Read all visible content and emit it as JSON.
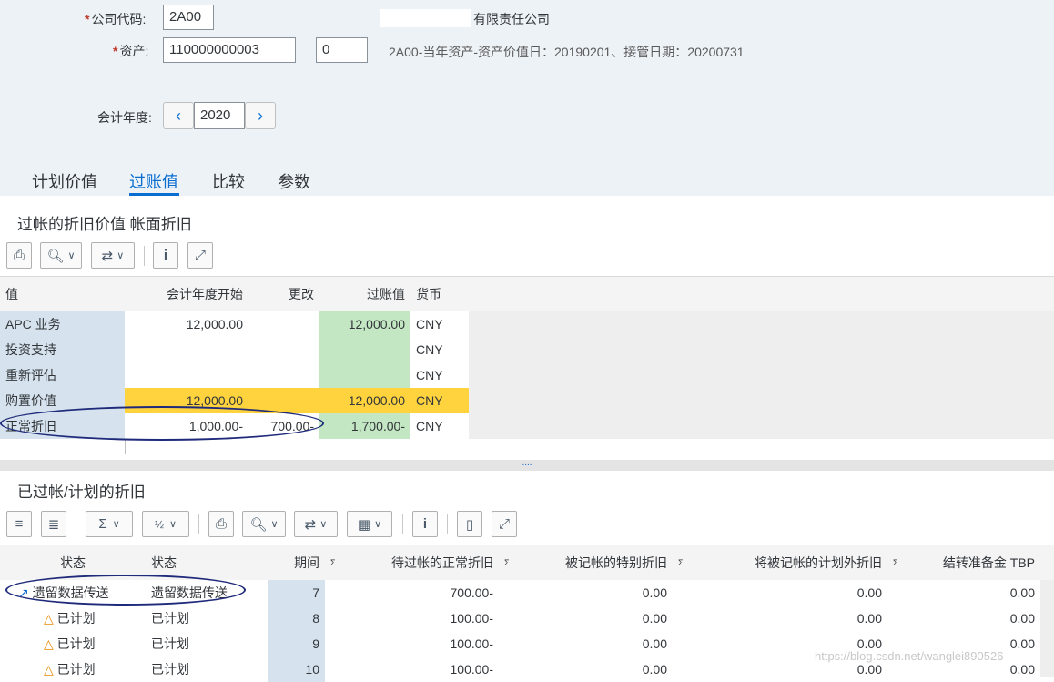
{
  "header": {
    "company_code_label": "公司代码:",
    "company_code_value": "2A00",
    "company_name": "有限责任公司",
    "asset_label": "资产:",
    "asset_value": "110000000003",
    "asset_sub_value": "0",
    "asset_description": "2A00-当年资产-资产价值日：20190201、接管日期：20200731",
    "fiscal_year_label": "会计年度:",
    "fiscal_year_value": "2020"
  },
  "tabs": [
    "计划价值",
    "过账值",
    "比较",
    "参数"
  ],
  "active_tab": "过账值",
  "section1": {
    "title": "过帐的折旧价值 帐面折旧",
    "columns": [
      "值",
      "会计年度开始",
      "更改",
      "过账值",
      "货币"
    ],
    "rows": [
      {
        "name": "APC 业务",
        "start": "12,000.00",
        "change": "",
        "posted": "12,000.00",
        "currency": "CNY"
      },
      {
        "name": "投资支持",
        "start": "",
        "change": "",
        "posted": "",
        "currency": "CNY"
      },
      {
        "name": "重新评估",
        "start": "",
        "change": "",
        "posted": "",
        "currency": "CNY"
      },
      {
        "name": "购置价值",
        "start": "12,000.00",
        "change": "",
        "posted": "12,000.00",
        "currency": "CNY"
      },
      {
        "name": "正常折旧",
        "start": "1,000.00-",
        "change": "700.00-",
        "posted": "1,700.00-",
        "currency": "CNY"
      }
    ]
  },
  "splitter_handle": "....",
  "section2": {
    "title": "已过帐/计划的折旧",
    "columns": [
      "状态",
      "状态",
      "期间",
      "待过帐的正常折旧",
      "被记帐的特别折旧",
      "将被记帐的计划外折旧",
      "结转准备金 TBP"
    ],
    "rows": [
      {
        "status_icon": "↗",
        "status": "遗留数据传送",
        "status_text": "遗留数据传送",
        "period": "7",
        "normal": "700.00-",
        "special": "0.00",
        "unplanned": "0.00",
        "reserve": "0.00"
      },
      {
        "status_icon": "△",
        "status": "已计划",
        "status_text": "已计划",
        "period": "8",
        "normal": "100.00-",
        "special": "0.00",
        "unplanned": "0.00",
        "reserve": "0.00"
      },
      {
        "status_icon": "△",
        "status": "已计划",
        "status_text": "已计划",
        "period": "9",
        "normal": "100.00-",
        "special": "0.00",
        "unplanned": "0.00",
        "reserve": "0.00"
      },
      {
        "status_icon": "△",
        "status": "已计划",
        "status_text": "已计划",
        "period": "10",
        "normal": "100.00-",
        "special": "0.00",
        "unplanned": "0.00",
        "reserve": "0.00"
      }
    ]
  },
  "watermark": "https://blog.csdn.net/wanglei890526",
  "colors": {
    "header_bg": "#edf2f7",
    "accent": "#0a6ed1",
    "key_col_bg": "#d6e3ef",
    "posted_green": "#c3e6c3",
    "highlight_yellow": "#ffd33d",
    "annotation_circle": "#1f2a7a"
  }
}
